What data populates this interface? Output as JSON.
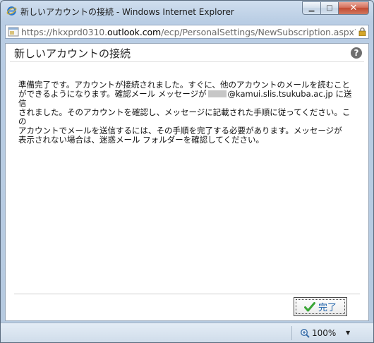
{
  "window": {
    "title": "新しいアカウントの接続 - Windows Internet Explorer",
    "minimize_label": "▁",
    "maximize_label": "□",
    "close_label": "✕"
  },
  "address": {
    "prefix": "https://hkxprd0310.",
    "domain": "outlook.com",
    "path": "/ecp/PersonalSettings/NewSubscription.aspx?p"
  },
  "dialog": {
    "title": "新しいアカウントの接続",
    "help_label": "?",
    "message_line1": "準備完了です。アカウントが接続されました。すぐに、他のアカウントのメールを読むこと",
    "message_line2a": "ができるようになります。確認メール メッセージが",
    "message_line2b": "@kamui.slis.tsukuba.ac.jp に送信",
    "message_line3": "されました。そのアカウントを確認し、メッセージに記載された手順に従ってください。この",
    "message_line4": "アカウントでメールを送信するには、その手順を完了する必要があります。メッセージが",
    "message_line5": "表示されない場合は、迷惑メール フォルダーを確認してください。",
    "done_label": "完了"
  },
  "status": {
    "zoom": "100%"
  },
  "colors": {
    "done_text": "#1b5fa8",
    "check": "#3aa635"
  }
}
